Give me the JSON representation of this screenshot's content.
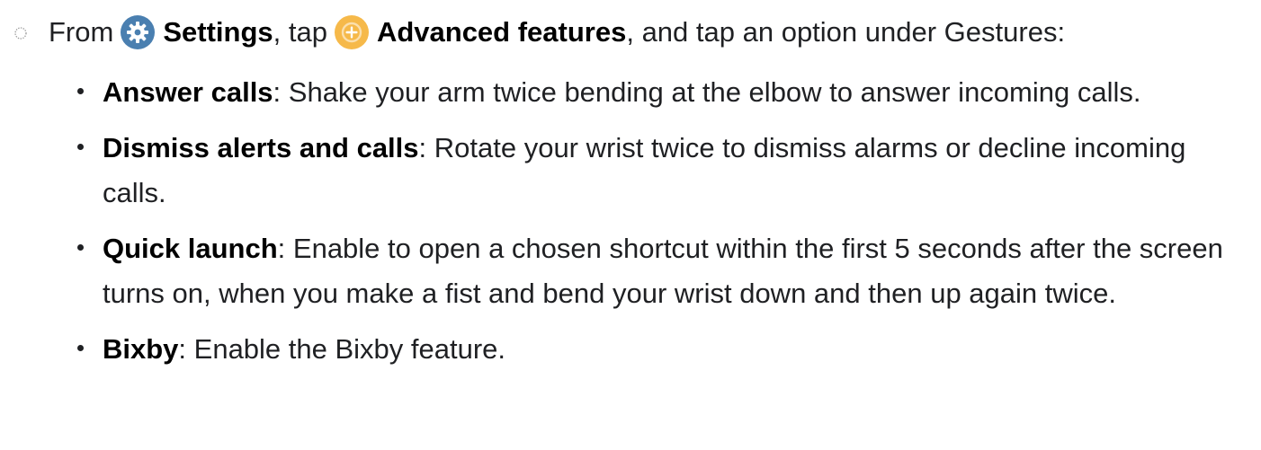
{
  "step": {
    "prefix": "From",
    "settings_label": "Settings",
    "settings_icon": "gear-icon",
    "settings_icon_color": "#4a7fb0",
    "middle": ", tap",
    "advanced_label": "Advanced features",
    "advanced_icon": "plus-icon",
    "advanced_icon_color": "#f6b94a",
    "suffix": ", and tap an option under Gestures:"
  },
  "bullets": [
    {
      "term": "Answer calls",
      "text": ": Shake your arm twice bending at the elbow to answer incoming calls."
    },
    {
      "term": "Dismiss alerts and calls",
      "text": ": Rotate your wrist twice to dismiss alarms or decline incoming calls."
    },
    {
      "term": "Quick launch",
      "text": ": Enable to open a chosen shortcut within the first 5 seconds after the screen turns on, when you make a fist and bend your wrist down and then up again twice."
    },
    {
      "term": "Bixby",
      "text": ": Enable the Bixby feature."
    }
  ]
}
